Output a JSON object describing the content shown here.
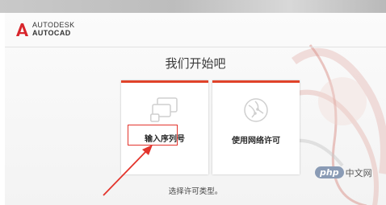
{
  "brand": {
    "line1": "AUTODESK",
    "line2": "AUTOCAD",
    "logo_icon": "autocad-a-logo-icon",
    "accent_color": "#e0432a"
  },
  "dialog": {
    "title": "我们开始吧",
    "options": [
      {
        "label": "输入序列号",
        "icon": "serial-number-screens-icon"
      },
      {
        "label": "使用网络许可",
        "icon": "network-globe-icon"
      }
    ],
    "footer": "选择许可类型。"
  },
  "annotation": {
    "highlight_color": "#e3342c"
  },
  "watermark": {
    "logo": "php",
    "text": "中文网"
  }
}
